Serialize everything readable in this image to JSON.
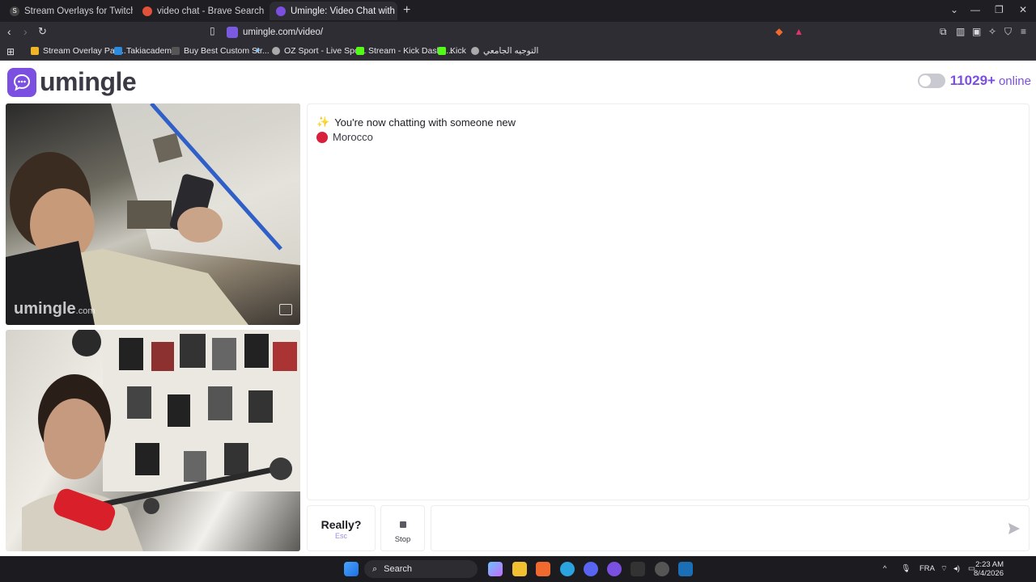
{
  "browser": {
    "tabs": [
      {
        "label": "Stream Overlays for Twitch, YouTube",
        "active": false
      },
      {
        "label": "video chat - Brave Search",
        "active": false
      },
      {
        "label": "Umingle: Video Chat with Str",
        "active": true
      }
    ],
    "url": "umingle.com/video/",
    "bookmarks": [
      "Stream Overlay Pac...",
      "Takiacademy",
      "Buy Best Custom Str...",
      "OZ Sport - Live Spo...",
      "Stream - Kick Dashb...",
      "Kick",
      "التوجيه الجامعي"
    ]
  },
  "site": {
    "logo_text": "umingle",
    "online_count": "11029+",
    "online_label": "online",
    "brand_color": "#7b4fe0"
  },
  "stranger_video": {
    "watermark": "umingle",
    "watermark_suffix": ".com"
  },
  "chat": {
    "system_message": "You're now chatting with someone new",
    "country": "Morocco"
  },
  "controls": {
    "really_label": "Really?",
    "really_hint": "Esc",
    "stop_label": "Stop",
    "message_placeholder": ""
  },
  "taskbar": {
    "search_label": "Search",
    "language": "FRA",
    "time": "2:23 AM",
    "date": "8/4/2026"
  }
}
